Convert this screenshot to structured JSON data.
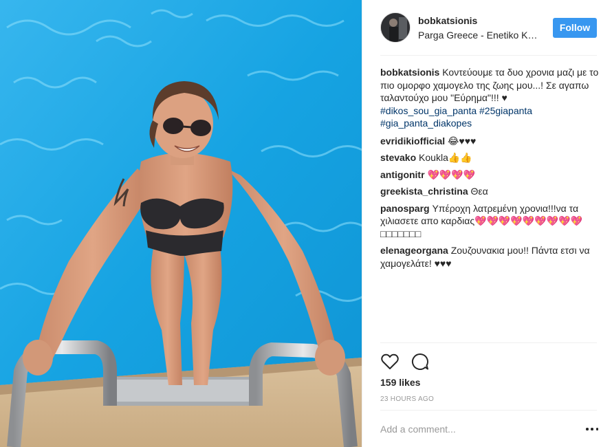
{
  "post": {
    "username": "bobkatsionis",
    "location": "Parga Greece - Enetiko Kastro",
    "follow_label": "Follow",
    "caption": {
      "user": "bobkatsionis",
      "text": "Κοντεύουμε τα δυο χρονια μαζι με το πιο ομορφο χαμογελο της ζωης μου...! Σε αγαπω ταλαντούχο μου \"Εύρημα\"!!! ♥",
      "hashtags": [
        "#dikos_sou_gia_panta",
        "#25giapanta",
        "#gia_panta_diakopes"
      ]
    },
    "comments": [
      {
        "user": "evridikiofficial",
        "text": "😂♥♥♥"
      },
      {
        "user": "stevako",
        "text": "Koukla👍👍"
      },
      {
        "user": "antigonitr",
        "text": "💖💖💖💖"
      },
      {
        "user": "greekista_christina",
        "text": "Θεα"
      },
      {
        "user": "panosparg",
        "text": "Υπέροχη λατρεμένη χρονια!!!να τα χιλιασετε απο καρδιας💖💖💖💖💖💖💖💖💖□□□□□□□"
      },
      {
        "user": "elenageorgana",
        "text": "Ζουζουνακια μου!! Πάντα ετσι να χαμογελάτε! ♥♥♥"
      }
    ],
    "likes": "159 likes",
    "time": "23 HOURS AGO",
    "add_comment_placeholder": "Add a comment...",
    "icons": {
      "like": "heart-outline-icon",
      "comment": "speech-bubble-icon",
      "more": "ellipsis-icon"
    }
  }
}
